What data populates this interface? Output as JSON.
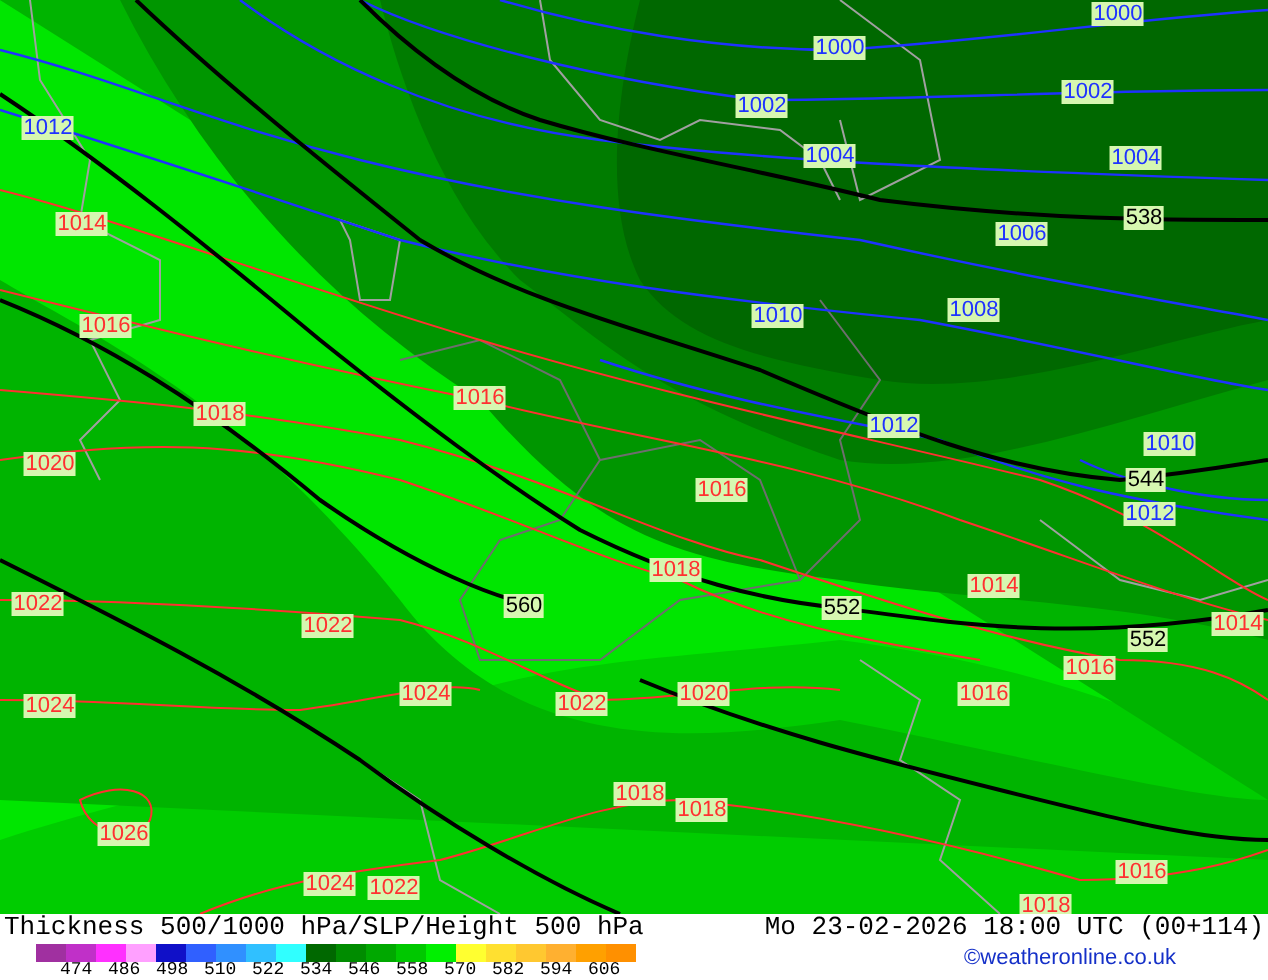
{
  "map": {
    "labels": [
      {
        "text": "1000",
        "kind": "isobar_low"
      },
      {
        "text": "1000",
        "kind": "isobar_low"
      },
      {
        "text": "1012",
        "kind": "isobar_low"
      },
      {
        "text": "1002",
        "kind": "isobar_low"
      },
      {
        "text": "1002",
        "kind": "isobar_low"
      },
      {
        "text": "1004",
        "kind": "isobar_low"
      },
      {
        "text": "1004",
        "kind": "isobar_low"
      },
      {
        "text": "1014",
        "kind": "isobar_high"
      },
      {
        "text": "1006",
        "kind": "isobar_low"
      },
      {
        "text": "538",
        "kind": "thickness"
      },
      {
        "text": "1016",
        "kind": "isobar_high"
      },
      {
        "text": "1010",
        "kind": "isobar_low"
      },
      {
        "text": "1008",
        "kind": "isobar_low"
      },
      {
        "text": "1018",
        "kind": "isobar_high"
      },
      {
        "text": "1016",
        "kind": "isobar_high"
      },
      {
        "text": "1012",
        "kind": "isobar_low"
      },
      {
        "text": "1020",
        "kind": "isobar_high"
      },
      {
        "text": "1010",
        "kind": "isobar_low"
      },
      {
        "text": "1016",
        "kind": "isobar_high"
      },
      {
        "text": "544",
        "kind": "thickness"
      },
      {
        "text": "1012",
        "kind": "isobar_low"
      },
      {
        "text": "1018",
        "kind": "isobar_high"
      },
      {
        "text": "1014",
        "kind": "isobar_high"
      },
      {
        "text": "1022",
        "kind": "isobar_high"
      },
      {
        "text": "1022",
        "kind": "isobar_high"
      },
      {
        "text": "560",
        "kind": "thickness"
      },
      {
        "text": "552",
        "kind": "thickness"
      },
      {
        "text": "1014",
        "kind": "isobar_high"
      },
      {
        "text": "552",
        "kind": "thickness"
      },
      {
        "text": "1016",
        "kind": "isobar_high"
      },
      {
        "text": "1024",
        "kind": "isobar_high"
      },
      {
        "text": "1024",
        "kind": "isobar_high"
      },
      {
        "text": "1022",
        "kind": "isobar_high"
      },
      {
        "text": "1020",
        "kind": "isobar_high"
      },
      {
        "text": "1016",
        "kind": "isobar_high"
      },
      {
        "text": "1018",
        "kind": "isobar_high"
      },
      {
        "text": "1018",
        "kind": "isobar_high"
      },
      {
        "text": "1026",
        "kind": "isobar_high"
      },
      {
        "text": "1024",
        "kind": "isobar_high"
      },
      {
        "text": "1022",
        "kind": "isobar_high"
      },
      {
        "text": "1016",
        "kind": "isobar_high"
      },
      {
        "text": "1018",
        "kind": "isobar_high"
      }
    ]
  },
  "footer": {
    "title": "Thickness 500/1000 hPa/SLP/Height 500 hPa",
    "valid_time": "Mo 23-02-2026 18:00 UTC (00+114)",
    "credit": "©weatheronline.co.uk",
    "legend": {
      "swatches": [
        {
          "color": "#a030a0"
        },
        {
          "color": "#c030c8"
        },
        {
          "color": "#ff30ff"
        },
        {
          "color": "#ffa0ff"
        },
        {
          "color": "#1010c8"
        },
        {
          "color": "#3060ff"
        },
        {
          "color": "#3090ff"
        },
        {
          "color": "#30c0ff"
        },
        {
          "color": "#30ffff"
        },
        {
          "color": "#006800"
        },
        {
          "color": "#008c00"
        },
        {
          "color": "#00a800"
        },
        {
          "color": "#00c800"
        },
        {
          "color": "#00f000"
        },
        {
          "color": "#ffff30"
        },
        {
          "color": "#ffe030"
        },
        {
          "color": "#ffc830"
        },
        {
          "color": "#ffb030"
        },
        {
          "color": "#ffa000"
        },
        {
          "color": "#ff9000"
        }
      ],
      "ticks": [
        "474",
        "486",
        "498",
        "510",
        "522",
        "534",
        "546",
        "558",
        "570",
        "582",
        "594",
        "606"
      ]
    }
  }
}
